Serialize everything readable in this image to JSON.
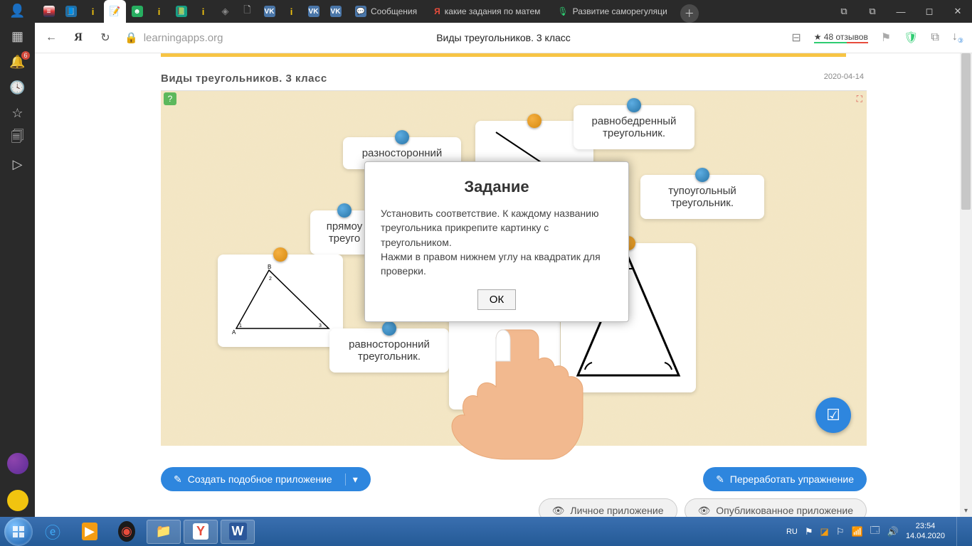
{
  "tabs": {
    "msg": "Сообщения",
    "search_prefix": "Я",
    "search": "какие задания по матем",
    "article": "Развитие саморегуляци"
  },
  "url": {
    "address": "learningapps.org",
    "page_title": "Виды треугольников. 3 класс",
    "reviews": "★ 48 отзывов"
  },
  "sidebar_badge": "6",
  "page": {
    "heading": "Виды треугольников. 3 класс",
    "date": "2020-04-14"
  },
  "cards": {
    "raznost": "разносторонний",
    "ravnobed": "равнобедренный треугольник.",
    "tupoug": "тупоугольный треугольник.",
    "pryam": "прямоу треуго",
    "ravnost": "равносторонний треугольник."
  },
  "modal": {
    "title": "Задание",
    "body": "Установить соответствие. К каждому названию треугольника прикрепите картинку с треугольником.\nНажми в правом нижнем углу на квадратик для проверки.",
    "ok": "ОК"
  },
  "actions": {
    "create": "Создать подобное приложение",
    "rework": "Переработать упражнение",
    "private": "Личное приложение",
    "public": "Опубликованное приложение"
  },
  "tray": {
    "lang": "RU",
    "time": "23:54",
    "date": "14.04.2020"
  }
}
